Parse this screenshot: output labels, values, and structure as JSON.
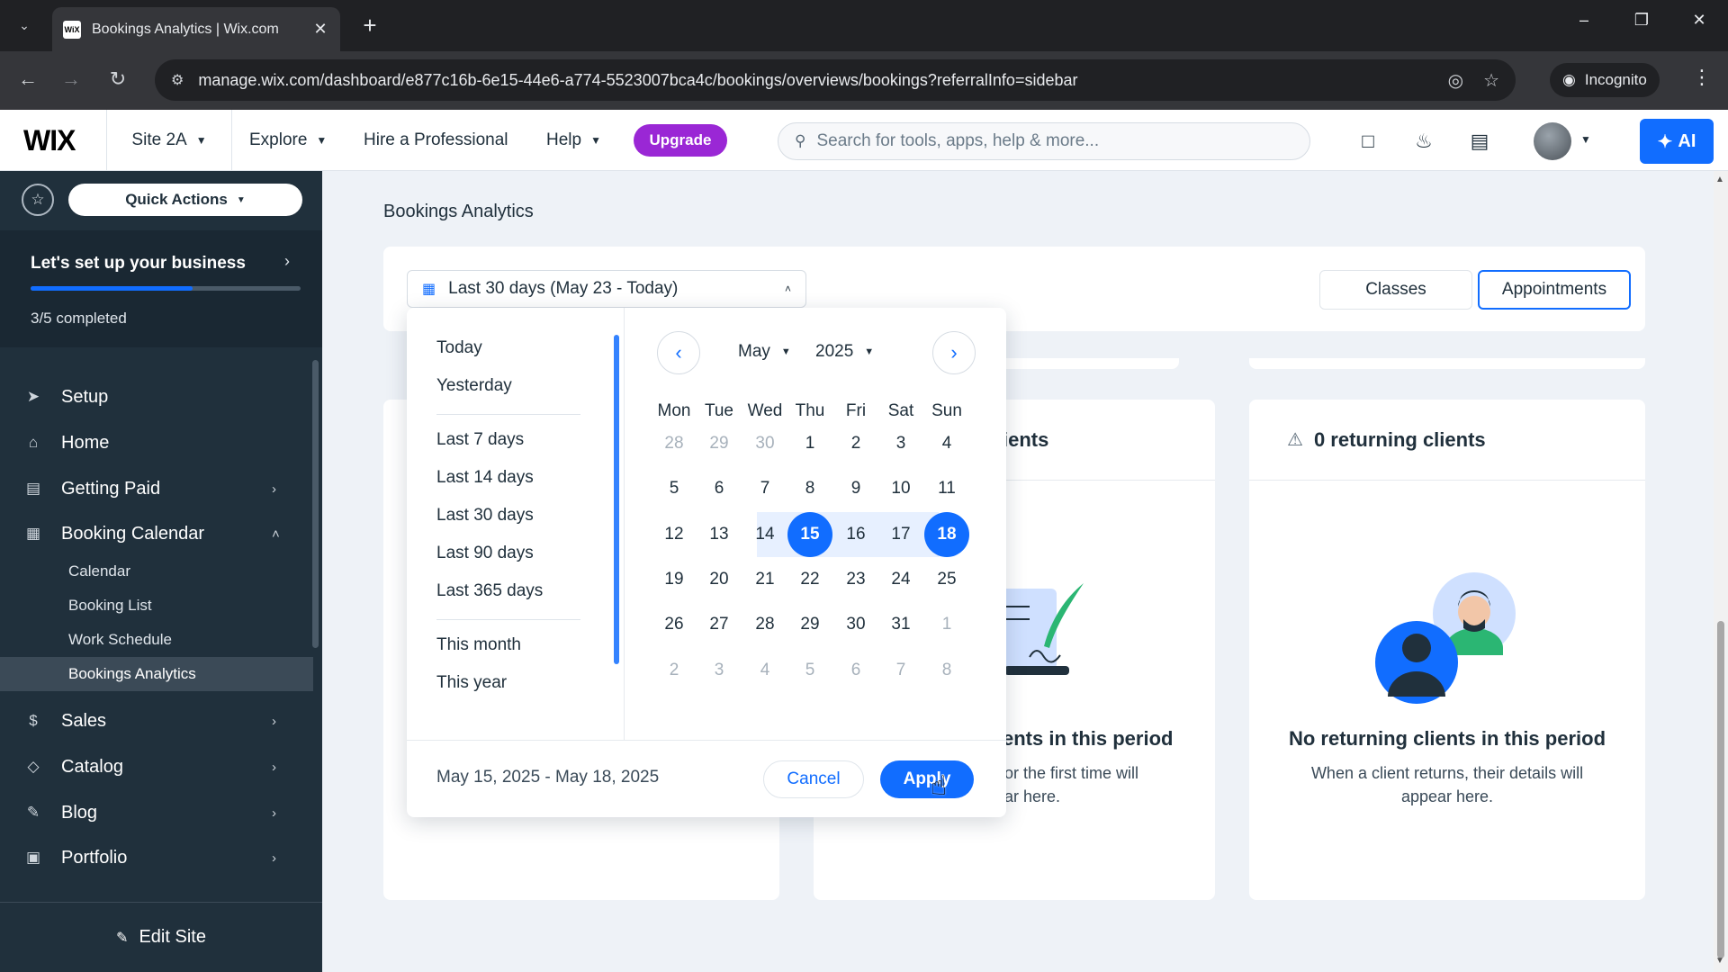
{
  "browser": {
    "tab_title": "Bookings Analytics | Wix.com",
    "favicon_text": "WiX",
    "url": "manage.wix.com/dashboard/e877c16b-6e15-44e6-a774-5523007bca4c/bookings/overviews/bookings?referralInfo=sidebar",
    "incognito_label": "Incognito"
  },
  "topbar": {
    "logo": "WIX",
    "site": "Site 2A",
    "explore": "Explore",
    "hire": "Hire a Professional",
    "help": "Help",
    "upgrade": "Upgrade",
    "search_placeholder": "Search for tools, apps, help & more...",
    "ai": "AI"
  },
  "sidebar": {
    "quick_actions": "Quick Actions",
    "setup_title": "Let's set up your business",
    "setup_count": "3/5 completed",
    "setup_progress": 0.6,
    "items": [
      {
        "label": "Setup"
      },
      {
        "label": "Home"
      },
      {
        "label": "Getting Paid"
      },
      {
        "label": "Booking Calendar"
      },
      {
        "label": "Sales"
      },
      {
        "label": "Catalog"
      },
      {
        "label": "Blog"
      },
      {
        "label": "Portfolio"
      }
    ],
    "sub_items": [
      {
        "label": "Calendar"
      },
      {
        "label": "Booking List"
      },
      {
        "label": "Work Schedule"
      },
      {
        "label": "Bookings Analytics"
      }
    ],
    "edit_site": "Edit Site"
  },
  "main": {
    "page_title": "Bookings Analytics",
    "date_range_label": "Last 30 days (May 23 - Today)",
    "segments": {
      "classes": "Classes",
      "appointments": "Appointments"
    },
    "cards": [
      {
        "header_partial": "ients",
        "empty_title_partial": "ents in this period",
        "empty_text_line1": "or the first time will",
        "empty_text_line2": "ar here."
      },
      {
        "header": "0 returning clients",
        "empty_title": "No returning clients in this period",
        "empty_text_line1": "When a client returns, their details will",
        "empty_text_line2": "appear here."
      }
    ]
  },
  "picker": {
    "presets": [
      "Today",
      "Yesterday",
      "Last 7 days",
      "Last 14 days",
      "Last 30 days",
      "Last 90 days",
      "Last 365 days",
      "This month",
      "This year"
    ],
    "month": "May",
    "year": "2025",
    "weekdays": [
      "Mon",
      "Tue",
      "Wed",
      "Thu",
      "Fri",
      "Sat",
      "Sun"
    ],
    "weeks": [
      [
        "28",
        "29",
        "30",
        "1",
        "2",
        "3",
        "4"
      ],
      [
        "5",
        "6",
        "7",
        "8",
        "9",
        "10",
        "11"
      ],
      [
        "12",
        "13",
        "14",
        "15",
        "16",
        "17",
        "18"
      ],
      [
        "19",
        "20",
        "21",
        "22",
        "23",
        "24",
        "25"
      ],
      [
        "26",
        "27",
        "28",
        "29",
        "30",
        "31",
        "1"
      ],
      [
        "2",
        "3",
        "4",
        "5",
        "6",
        "7",
        "8"
      ]
    ],
    "selected_range_text": "May 15, 2025 - May 18, 2025",
    "cancel": "Cancel",
    "apply": "Apply"
  },
  "colors": {
    "accent": "#116dff",
    "sidebar": "#20303c",
    "upgrade": "#9a27d5"
  }
}
